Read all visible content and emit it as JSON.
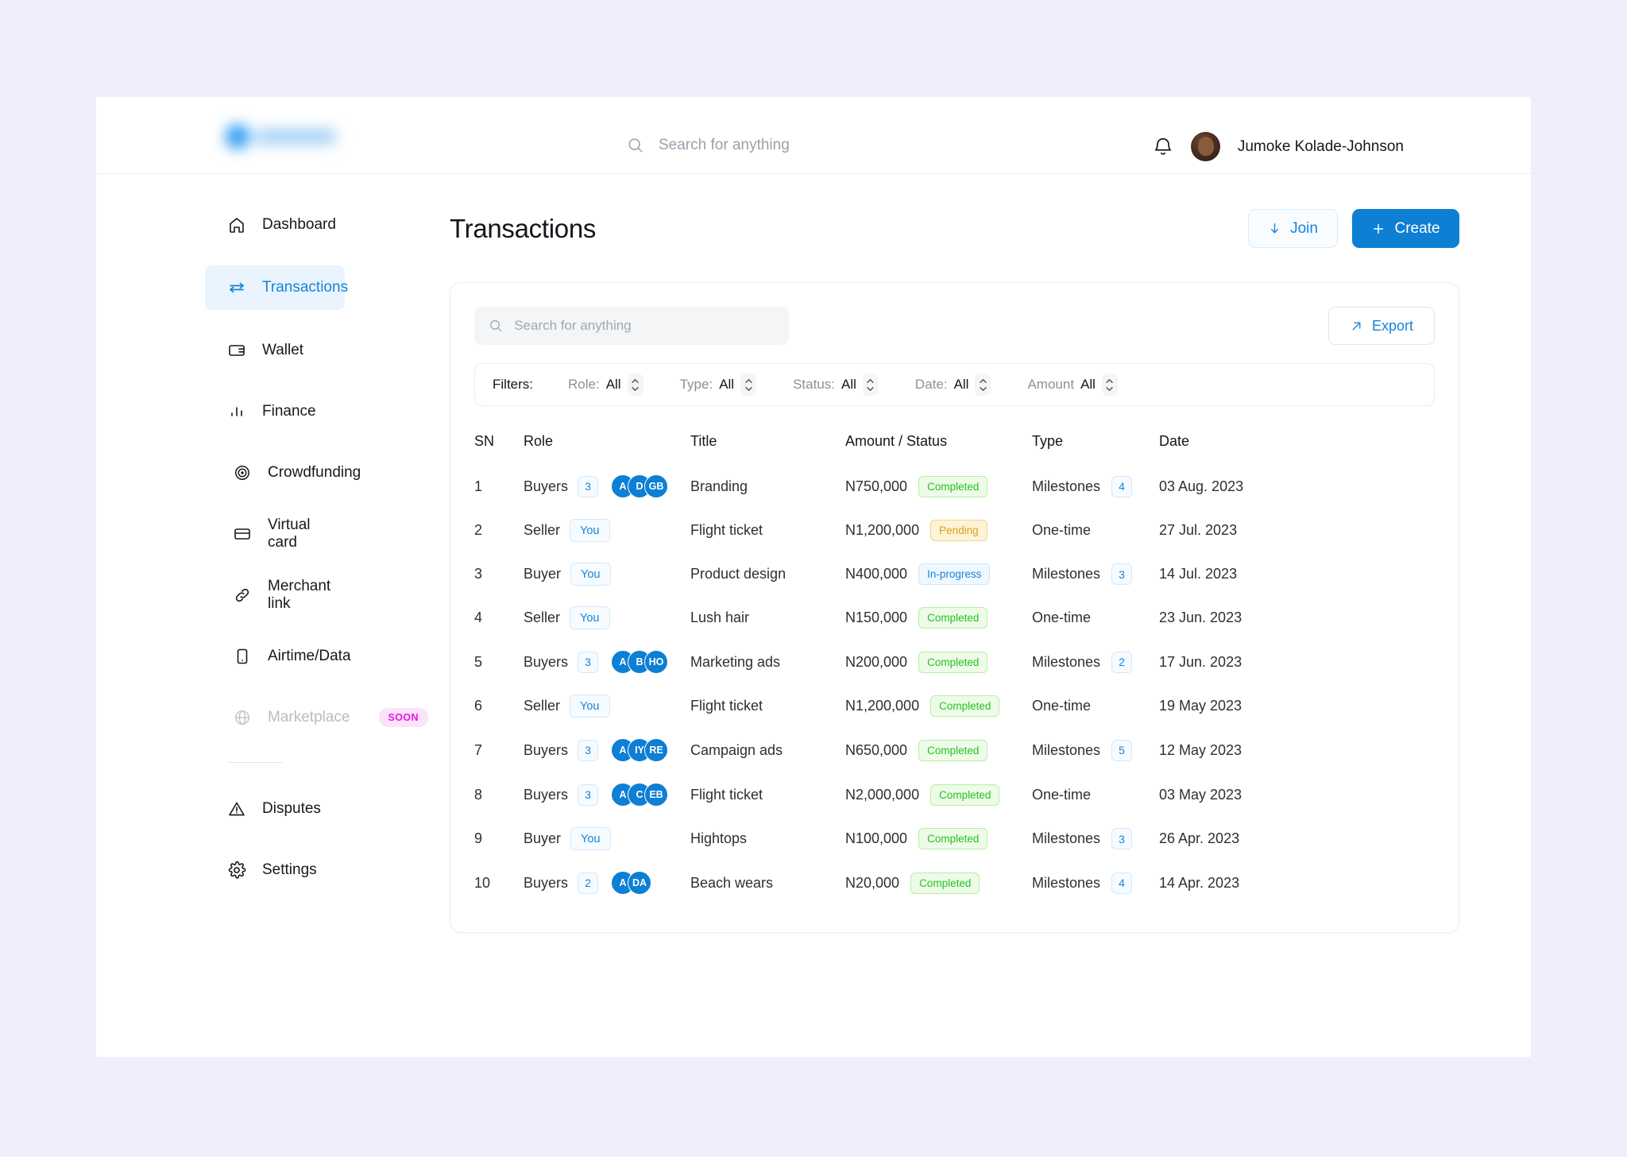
{
  "header": {
    "logo_alt": "company-logo",
    "search_placeholder": "Search for anything",
    "search_value": "",
    "notification_icon": "bell-icon",
    "user_name": "Jumoke Kolade-Johnson"
  },
  "sidebar": {
    "items": [
      {
        "label": "Dashboard",
        "icon": "home-icon",
        "active": false
      },
      {
        "label": "Transactions",
        "icon": "transfer-icon",
        "active": true
      },
      {
        "label": "Wallet",
        "icon": "wallet-icon",
        "active": false
      },
      {
        "label": "Finance",
        "icon": "bar-chart-icon",
        "active": false,
        "expandable": true
      }
    ],
    "sub_items": [
      {
        "label": "Crowdfunding",
        "icon": "target-icon"
      },
      {
        "label": "Virtual card",
        "icon": "credit-card-icon"
      },
      {
        "label": "Merchant link",
        "icon": "link-icon"
      },
      {
        "label": "Airtime/Data",
        "icon": "phone-icon"
      },
      {
        "label": "Marketplace",
        "icon": "globe-icon",
        "disabled": true,
        "badge": "SOON"
      }
    ],
    "bottom_items": [
      {
        "label": "Disputes",
        "icon": "alert-triangle-icon"
      },
      {
        "label": "Settings",
        "icon": "gear-icon"
      }
    ]
  },
  "page": {
    "title": "Transactions",
    "join_label": "Join",
    "create_label": "Create"
  },
  "card": {
    "search_placeholder": "Search for anything",
    "search_value": "",
    "export_label": "Export",
    "filters_label": "Filters:",
    "filters": [
      {
        "key": "Role:",
        "value": "All"
      },
      {
        "key": "Type:",
        "value": "All"
      },
      {
        "key": "Status:",
        "value": "All"
      },
      {
        "key": "Date:",
        "value": "All"
      },
      {
        "key": "Amount",
        "value": "All"
      }
    ]
  },
  "table": {
    "columns": [
      "SN",
      "Role",
      "Title",
      "Amount / Status",
      "Type",
      "Date"
    ],
    "rows": [
      {
        "sn": "1",
        "role": "Buyers",
        "count": "3",
        "avatars": [
          "A",
          "D",
          "GB"
        ],
        "you": false,
        "title": "Branding",
        "amount": "N750,000",
        "status": "Completed",
        "status_kind": "completed",
        "type": "Milestones",
        "type_count": "4",
        "date": "03 Aug. 2023"
      },
      {
        "sn": "2",
        "role": "Seller",
        "count": null,
        "avatars": [],
        "you": true,
        "you_label": "You",
        "title": "Flight ticket",
        "amount": "N1,200,000",
        "status": "Pending",
        "status_kind": "pending",
        "type": "One-time",
        "type_count": null,
        "date": "27 Jul. 2023"
      },
      {
        "sn": "3",
        "role": "Buyer",
        "count": null,
        "avatars": [],
        "you": true,
        "you_label": "You",
        "title": "Product design",
        "amount": "N400,000",
        "status": "In-progress",
        "status_kind": "inprogress",
        "type": "Milestones",
        "type_count": "3",
        "date": "14 Jul. 2023"
      },
      {
        "sn": "4",
        "role": "Seller",
        "count": null,
        "avatars": [],
        "you": true,
        "you_label": "You",
        "title": "Lush hair",
        "amount": "N150,000",
        "status": "Completed",
        "status_kind": "completed",
        "type": "One-time",
        "type_count": null,
        "date": "23 Jun. 2023"
      },
      {
        "sn": "5",
        "role": "Buyers",
        "count": "3",
        "avatars": [
          "A",
          "B",
          "HO"
        ],
        "you": false,
        "title": "Marketing ads",
        "amount": "N200,000",
        "status": "Completed",
        "status_kind": "completed",
        "type": "Milestones",
        "type_count": "2",
        "date": "17 Jun. 2023"
      },
      {
        "sn": "6",
        "role": "Seller",
        "count": null,
        "avatars": [],
        "you": true,
        "you_label": "You",
        "title": "Flight ticket",
        "amount": "N1,200,000",
        "status": "Completed",
        "status_kind": "completed",
        "type": "One-time",
        "type_count": null,
        "date": "19 May 2023"
      },
      {
        "sn": "7",
        "role": "Buyers",
        "count": "3",
        "avatars": [
          "A",
          "IY",
          "RE"
        ],
        "you": false,
        "title": "Campaign ads",
        "amount": "N650,000",
        "status": "Completed",
        "status_kind": "completed",
        "type": "Milestones",
        "type_count": "5",
        "date": "12 May 2023"
      },
      {
        "sn": "8",
        "role": "Buyers",
        "count": "3",
        "avatars": [
          "A",
          "C",
          "EB"
        ],
        "you": false,
        "title": "Flight ticket",
        "amount": "N2,000,000",
        "status": "Completed",
        "status_kind": "completed",
        "type": "One-time",
        "type_count": null,
        "date": "03 May 2023"
      },
      {
        "sn": "9",
        "role": "Buyer",
        "count": null,
        "avatars": [],
        "you": true,
        "you_label": "You",
        "title": "Hightops",
        "amount": "N100,000",
        "status": "Completed",
        "status_kind": "completed",
        "type": "Milestones",
        "type_count": "3",
        "date": "26 Apr. 2023"
      },
      {
        "sn": "10",
        "role": "Buyers",
        "count": "2",
        "avatars": [
          "A",
          "DA"
        ],
        "you": false,
        "title": "Beach wears",
        "amount": "N20,000",
        "status": "Completed",
        "status_kind": "completed",
        "type": "Milestones",
        "type_count": "4",
        "date": "14 Apr. 2023"
      }
    ]
  },
  "colors": {
    "page_background": "#efeefc",
    "accent_blue": "#1683d8",
    "primary_button": "#0d7fd4",
    "status_completed": "#22c41f",
    "status_pending": "#d9a21b",
    "status_inprogress": "#1683d8",
    "soon_badge": "#e21ae2"
  }
}
